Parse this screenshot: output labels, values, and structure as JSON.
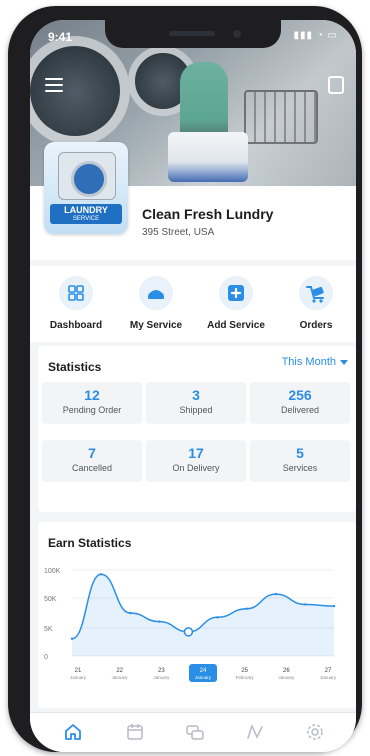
{
  "status": {
    "time": "9:41",
    "icons": "▮▮▮ ◔ ▭"
  },
  "shop": {
    "name": "Clean Fresh Lundry",
    "address": "395 Street, USA",
    "logo_text": "LAUNDRY",
    "logo_subtext": "SERVICE"
  },
  "actions": [
    {
      "label": "Dashboard",
      "icon": "dashboard-grid-icon"
    },
    {
      "label": "My Service",
      "icon": "service-icon"
    },
    {
      "label": "Add Service",
      "icon": "add-service-icon"
    },
    {
      "label": "Orders",
      "icon": "orders-cart-icon"
    }
  ],
  "statistics": {
    "title": "Statistics",
    "filter": "This Month",
    "cards": [
      {
        "value": "12",
        "label": "Pending Order"
      },
      {
        "value": "3",
        "label": "Shipped"
      },
      {
        "value": "256",
        "label": "Delivered"
      },
      {
        "value": "7",
        "label": "Cancelled"
      },
      {
        "value": "17",
        "label": "On Delivery"
      },
      {
        "value": "5",
        "label": "Services"
      }
    ]
  },
  "earn": {
    "title": "Earn Statistics",
    "selected_index": 4
  },
  "chart_data": {
    "type": "area",
    "title": "Earn Statistics",
    "yticks": [
      "100K",
      "50K",
      "5K",
      "0"
    ],
    "ylim": [
      0,
      100000
    ],
    "x": [
      {
        "day": "21",
        "month": "January"
      },
      {
        "day": "22",
        "month": "January"
      },
      {
        "day": "23",
        "month": "January"
      },
      {
        "day": "24",
        "month": "January"
      },
      {
        "day": "25",
        "month": "February"
      },
      {
        "day": "26",
        "month": "January"
      },
      {
        "day": "27",
        "month": "January"
      }
    ],
    "values": [
      20000,
      95000,
      50000,
      40000,
      28000,
      45000,
      55000,
      72000,
      60000,
      58000
    ],
    "accent_color": "#2b8ee6",
    "grid": true
  },
  "tabs": [
    {
      "icon": "home-icon",
      "active": true
    },
    {
      "icon": "calendar-icon",
      "active": false
    },
    {
      "icon": "chat-icon",
      "active": false
    },
    {
      "icon": "map-icon",
      "active": false
    },
    {
      "icon": "settings-icon",
      "active": false
    }
  ],
  "colors": {
    "accent": "#2b8ee6",
    "tile_bg": "#f3f4f6"
  }
}
